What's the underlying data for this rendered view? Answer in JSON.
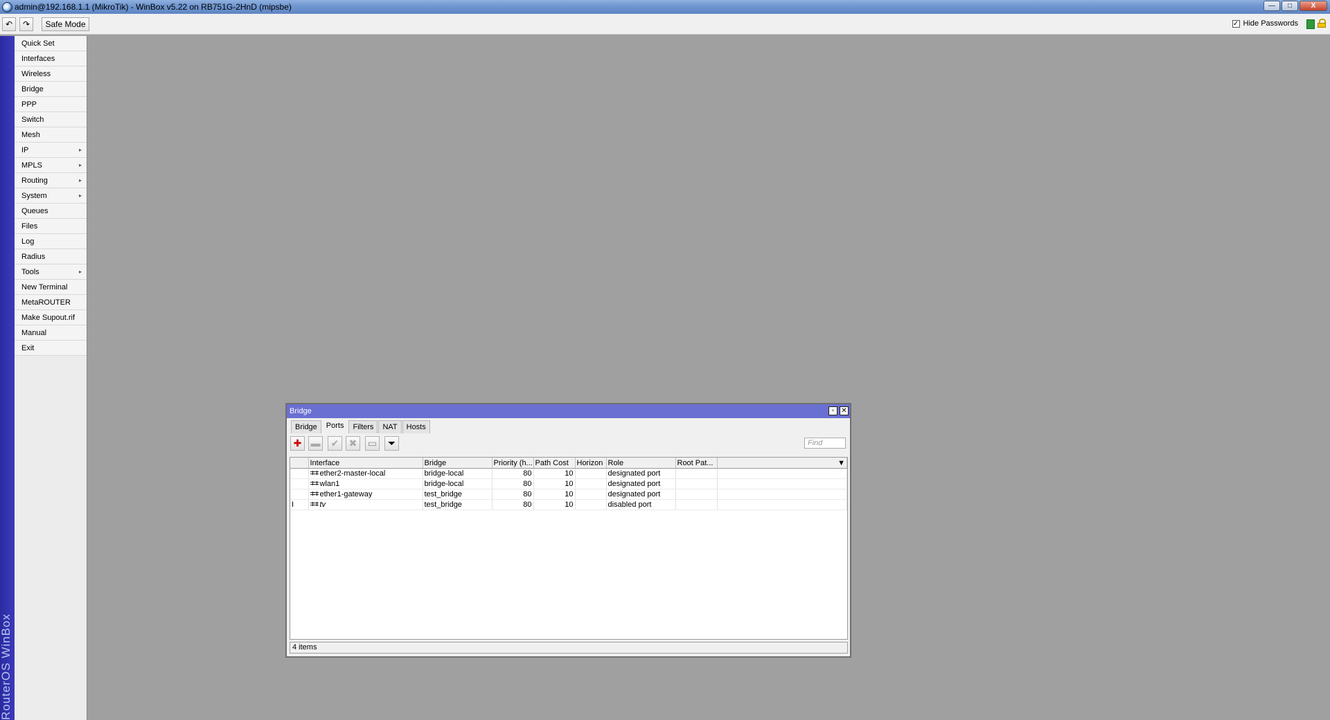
{
  "app": {
    "title": "admin@192.168.1.1 (MikroTik) - WinBox v5.22 on RB751G-2HnD (mipsbe)",
    "window_buttons": [
      "—",
      "□",
      "X"
    ]
  },
  "toolbar": {
    "undo_icon": "undo-icon",
    "redo_icon": "redo-icon",
    "safe_mode_label": "Safe Mode",
    "hide_passwords_label": "Hide Passwords",
    "hide_passwords_checked": "✓"
  },
  "brand": {
    "text": "RouterOS WinBox"
  },
  "menu": {
    "items": [
      {
        "label": "Quick Set"
      },
      {
        "label": "Interfaces"
      },
      {
        "label": "Wireless"
      },
      {
        "label": "Bridge"
      },
      {
        "label": "PPP"
      },
      {
        "label": "Switch"
      },
      {
        "label": "Mesh"
      },
      {
        "label": "IP",
        "arrow": "▸"
      },
      {
        "label": "MPLS",
        "arrow": "▸"
      },
      {
        "label": "Routing",
        "arrow": "▸"
      },
      {
        "label": "System",
        "arrow": "▸"
      },
      {
        "label": "Queues"
      },
      {
        "label": "Files"
      },
      {
        "label": "Log"
      },
      {
        "label": "Radius"
      },
      {
        "label": "Tools",
        "arrow": "▸"
      },
      {
        "label": "New Terminal"
      },
      {
        "label": "MetaROUTER"
      },
      {
        "label": "Make Supout.rif"
      },
      {
        "label": "Manual"
      },
      {
        "label": "Exit"
      }
    ]
  },
  "bridge_window": {
    "title": "Bridge",
    "tabs": [
      "Bridge",
      "Ports",
      "Filters",
      "NAT",
      "Hosts"
    ],
    "active_tab": "Ports",
    "find_placeholder": "Find",
    "columns": [
      "Interface",
      "Bridge",
      "Priority (h...",
      "Path Cost",
      "Horizon",
      "Role",
      "Root Pat..."
    ],
    "rows": [
      {
        "flag": "",
        "interface": "ether2-master-local",
        "bridge": "bridge-local",
        "priority": "80",
        "path_cost": "10",
        "horizon": "",
        "role": "designated port",
        "root_path": ""
      },
      {
        "flag": "",
        "interface": "wlan1",
        "bridge": "bridge-local",
        "priority": "80",
        "path_cost": "10",
        "horizon": "",
        "role": "designated port",
        "root_path": ""
      },
      {
        "flag": "",
        "interface": "ether1-gateway",
        "bridge": "test_bridge",
        "priority": "80",
        "path_cost": "10",
        "horizon": "",
        "role": "designated port",
        "root_path": ""
      },
      {
        "flag": "I",
        "interface": "tv",
        "bridge": "test_bridge",
        "priority": "80",
        "path_cost": "10",
        "horizon": "",
        "role": "disabled port",
        "root_path": ""
      }
    ],
    "status": "4 items"
  }
}
